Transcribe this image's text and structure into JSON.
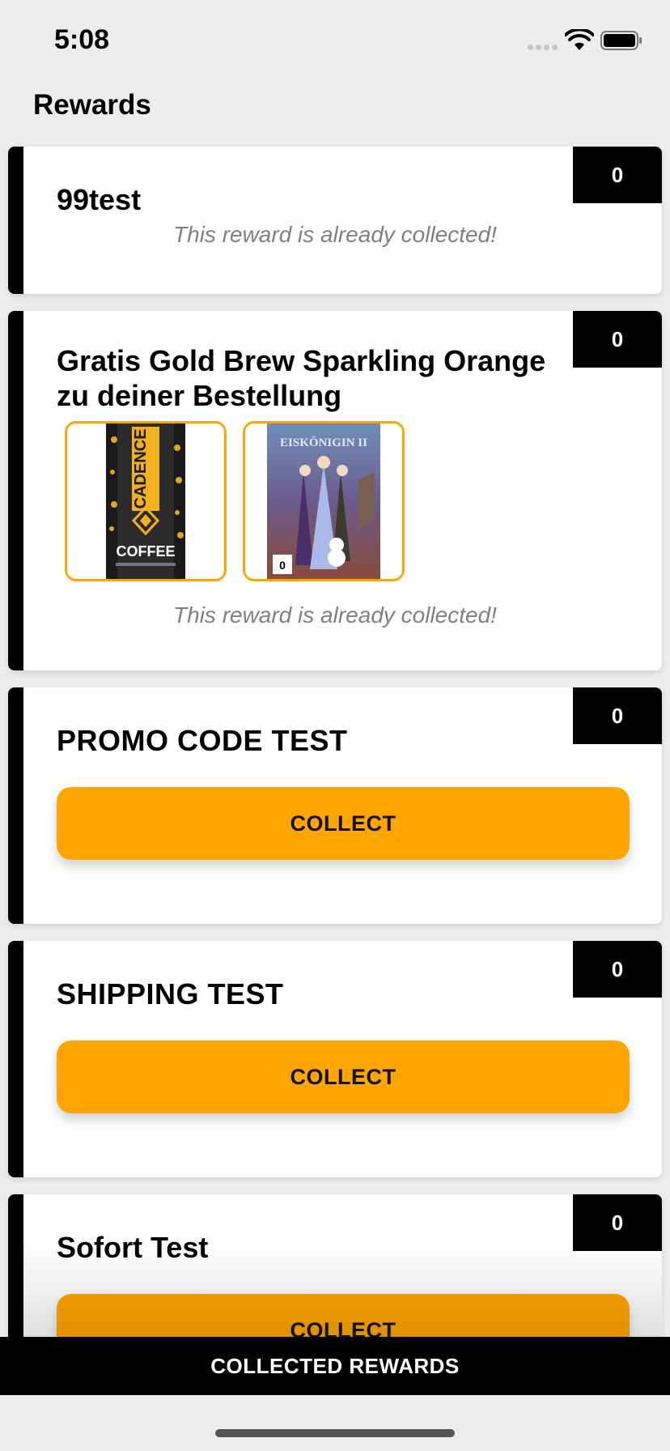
{
  "status_bar": {
    "time": "5:08"
  },
  "page": {
    "title": "Rewards"
  },
  "rewards": [
    {
      "title": "99test",
      "count": "0",
      "status": "This reward is already collected!"
    },
    {
      "title": "Gratis Gold Brew Sparkling Orange zu deiner Bestellung",
      "count": "0",
      "status": "This reward is already collected!",
      "products": [
        {
          "name": "CADENCE",
          "subtitle": "COFFEE"
        },
        {
          "name": "EISKÖNIGIN II"
        }
      ]
    },
    {
      "title": "PROMO CODE TEST",
      "count": "0",
      "button": "COLLECT"
    },
    {
      "title": "SHIPPING TEST",
      "count": "0",
      "button": "COLLECT"
    },
    {
      "title": "Sofort Test",
      "count": "0",
      "button": "COLLECT"
    }
  ],
  "footer": {
    "label": "COLLECTED REWARDS"
  },
  "colors": {
    "accent": "#ffa500",
    "bar": "#000000",
    "background": "#ededed"
  }
}
